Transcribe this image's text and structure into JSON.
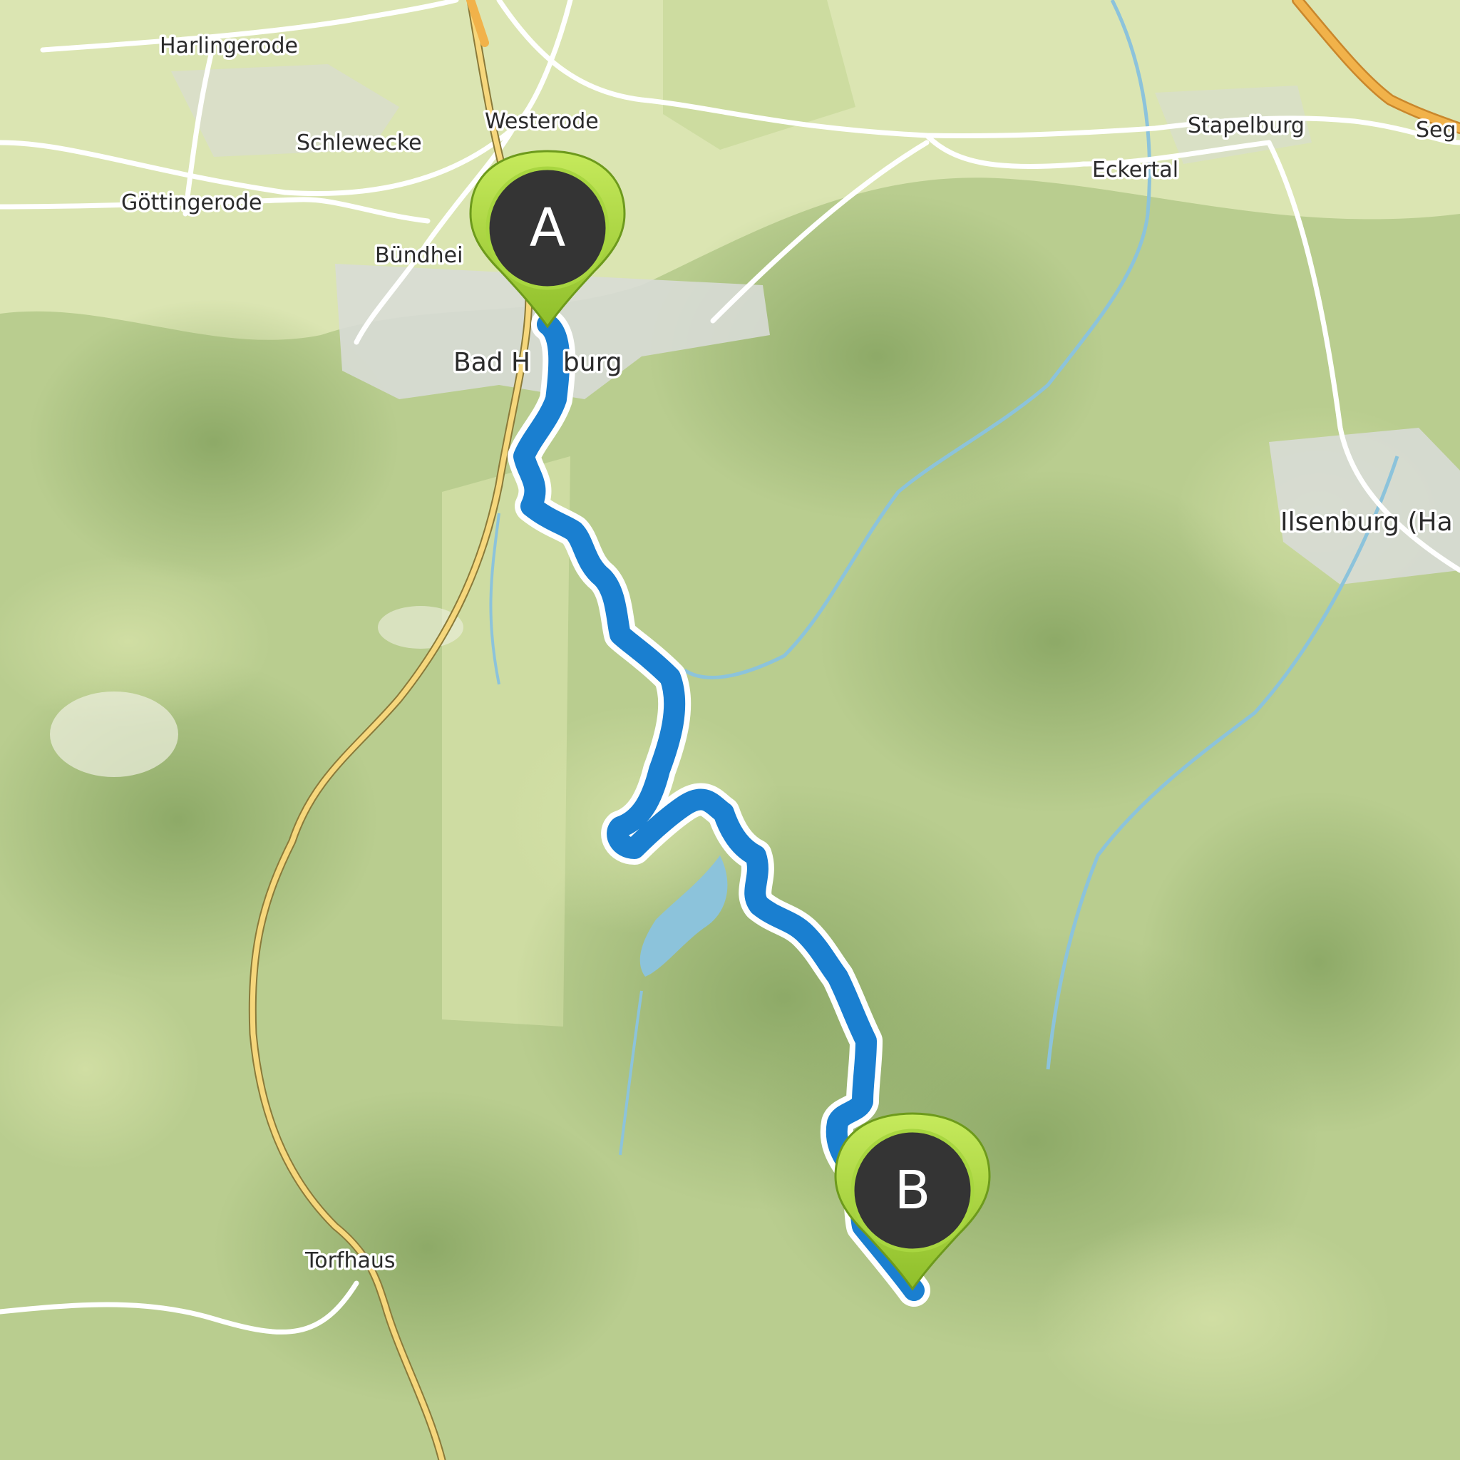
{
  "map": {
    "places": [
      {
        "id": "harlingerode",
        "name": "Harlingerode"
      },
      {
        "id": "westerode",
        "name": "Westerode"
      },
      {
        "id": "schlewecke",
        "name": "Schlewecke"
      },
      {
        "id": "goettingerode",
        "name": "Göttingerode"
      },
      {
        "id": "buendheim",
        "name": "Bündhei"
      },
      {
        "id": "bad-harzburg",
        "name": "Bad H    burg"
      },
      {
        "id": "stapelburg",
        "name": "Stapelburg"
      },
      {
        "id": "eckertal",
        "name": "Eckertal"
      },
      {
        "id": "seg",
        "name": "Seg"
      },
      {
        "id": "ilsenburg",
        "name": "Ilsenburg (Ha"
      },
      {
        "id": "torfhaus",
        "name": "Torfhaus"
      }
    ],
    "markers": {
      "start": {
        "label": "A"
      },
      "end": {
        "label": "B"
      }
    },
    "colors": {
      "route": "#1a7fd0",
      "route_outline": "#ffffff",
      "marker_fill": "#343434",
      "marker_ring": "#a8d640",
      "water": "#8cc3db",
      "road_major": "#f6d77c",
      "road_highway": "#f1b24a",
      "road_minor": "#ffffff",
      "urban": "#d9dcd6",
      "forest_dark": "#8fae67",
      "meadow": "#d8e3ad"
    }
  }
}
